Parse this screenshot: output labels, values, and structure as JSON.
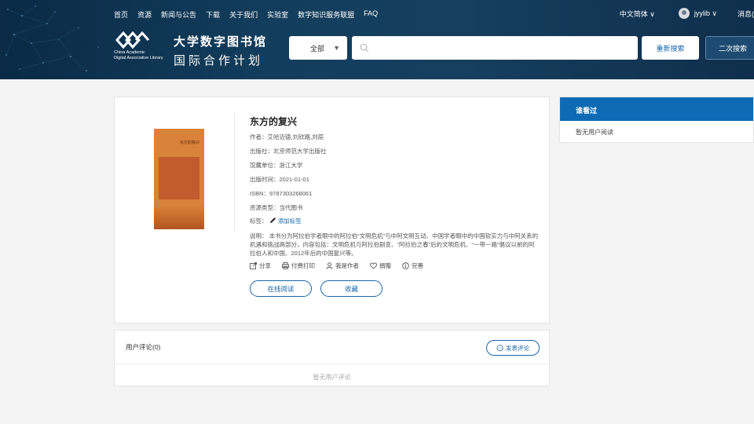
{
  "nav": {
    "items": [
      "首页",
      "资源",
      "新闻与公告",
      "下载",
      "关于我们",
      "实验室",
      "数字知识服务联盟",
      "FAQ"
    ],
    "language": "中文简体",
    "username": "jyylib",
    "messages": "消息("
  },
  "brand": {
    "name_en_line1": "China Academic",
    "name_en_line2": "Digital Associative Library",
    "name_cn_line1": "大学数字图书馆",
    "name_cn_line2": "国际合作计划"
  },
  "search": {
    "scope": "全部",
    "placeholder": "",
    "research_label": "重新搜索",
    "second_search_label": "二次搜索"
  },
  "book": {
    "title": "东方的复兴",
    "cover_title": "东方的复兴",
    "author_label": "作者：",
    "author": "艾哈迈德,刘欣路,刘辰",
    "publisher_label": "出版社：",
    "publisher": "北京师范大学出版社",
    "holding_label": "馆藏单位：",
    "holding": "浙江大学",
    "date_label": "出版时间：",
    "date": "2021-01-01",
    "isbn_label": "ISBN：",
    "isbn": "9787303268061",
    "type_label": "资源类型：",
    "type": "当代图书",
    "tags_label": "标签：",
    "add_tag": "添加标签",
    "description": "说明： 本书分为阿拉伯学者眼中的阿拉伯“文明危机”与中阿文明互动、中国学者眼中的中国软实力与中阿关系的机遇和挑战两部分，内容包括：文明危机与阿拉伯剧变、“阿拉伯之春”后的文明危机、“一带一路”倡议以前的阿拉伯人和中国、2012年后的中国复兴等。"
  },
  "actions": {
    "share": "分享",
    "print": "付费打印",
    "author": "我是作者",
    "donate": "捐赠",
    "improve": "完善",
    "read_online": "在线阅读",
    "favorite": "收藏"
  },
  "comments": {
    "header": "用户评论(0)",
    "post_button": "发表评论",
    "empty": "暂无用户评论"
  },
  "side": {
    "header": "谁看过",
    "empty": "暂无用户阅读"
  }
}
